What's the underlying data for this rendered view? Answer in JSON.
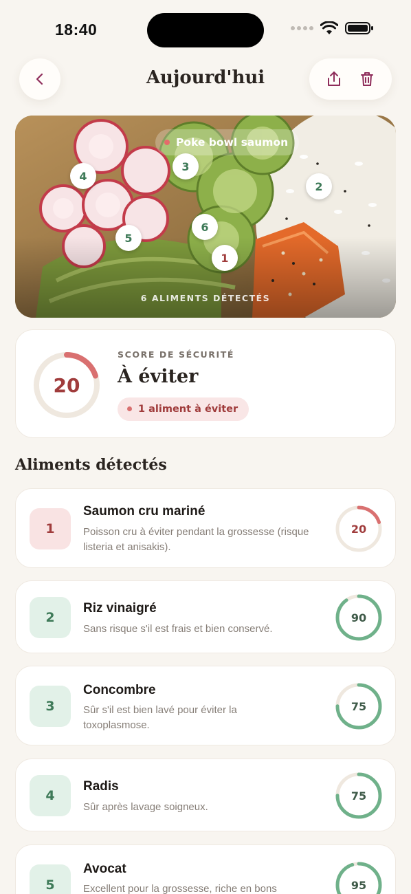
{
  "status": {
    "time": "18:40"
  },
  "header": {
    "title": "Aujourd'hui"
  },
  "photo": {
    "dish": "Poke bowl saumon",
    "detected": "6 ALIMENTS DÉTECTÉS",
    "markers": [
      "1",
      "2",
      "3",
      "4",
      "5",
      "6"
    ]
  },
  "score": {
    "label": "SCORE DE SÉCURITÉ",
    "value": "20",
    "value_fraction": 0.2,
    "verdict": "À éviter",
    "badge": "1 aliment à éviter"
  },
  "section": {
    "title": "Aliments détectés"
  },
  "foods": [
    {
      "num": "1",
      "name": "Saumon cru mariné",
      "desc": "Poisson cru à éviter pendant la grossesse (risque listeria et anisakis).",
      "score": "20",
      "fraction": 0.2,
      "status": "danger"
    },
    {
      "num": "2",
      "name": "Riz vinaigré",
      "desc": "Sans risque s'il est frais et bien conservé.",
      "score": "90",
      "fraction": 0.9,
      "status": "safe"
    },
    {
      "num": "3",
      "name": "Concombre",
      "desc": "Sûr s'il est bien lavé pour éviter la toxoplasmose.",
      "score": "75",
      "fraction": 0.75,
      "status": "safe"
    },
    {
      "num": "4",
      "name": "Radis",
      "desc": "Sûr après lavage soigneux.",
      "score": "75",
      "fraction": 0.75,
      "status": "safe"
    },
    {
      "num": "5",
      "name": "Avocat",
      "desc": "Excellent pour la grossesse, riche en bons",
      "score": "95",
      "fraction": 0.95,
      "status": "safe"
    }
  ],
  "colors": {
    "danger": "#D97070",
    "safe": "#6FB18A",
    "track": "#EFE8DF"
  }
}
